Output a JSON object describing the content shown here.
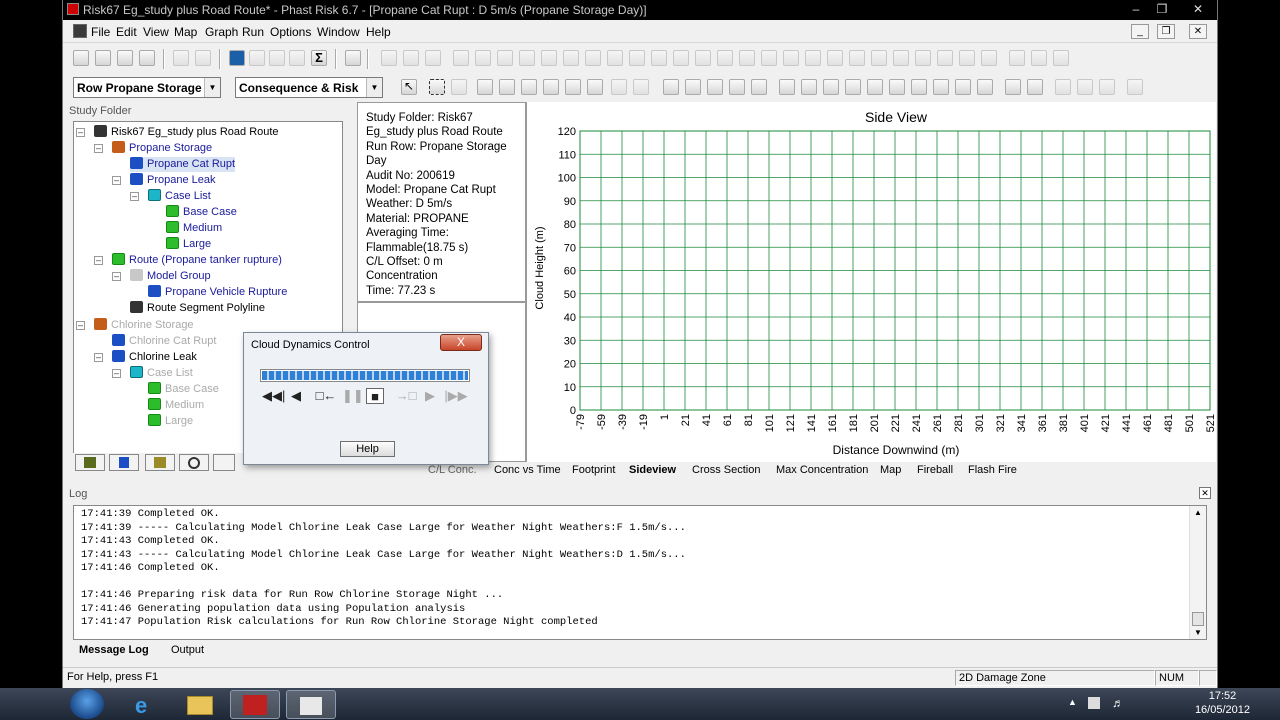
{
  "window": {
    "title": "Risk67 Eg_study plus Road Route* - Phast Risk 6.7 - [Propane Cat Rupt : D 5m/s (Propane Storage Day)]"
  },
  "menu": [
    "File",
    "Edit",
    "View",
    "Map",
    "Graph",
    "Run",
    "Options",
    "Window",
    "Help"
  ],
  "toolbar": {
    "run_row_combo": "Row Propane Storage",
    "results_combo": "Consequence & Risk"
  },
  "study_folder": {
    "title": "Study Folder",
    "nodes": [
      {
        "label": "Risk67 Eg_study plus Road Route"
      },
      {
        "label": "Propane Storage"
      },
      {
        "label": "Propane Cat Rupt"
      },
      {
        "label": "Propane Leak"
      },
      {
        "label": "Case List"
      },
      {
        "label": "Base Case"
      },
      {
        "label": "Medium"
      },
      {
        "label": "Large"
      },
      {
        "label": "Route (Propane tanker rupture)"
      },
      {
        "label": "Model Group"
      },
      {
        "label": "Propane Vehicle Rupture"
      },
      {
        "label": "Route Segment Polyline"
      },
      {
        "label": "Chlorine Storage"
      },
      {
        "label": "Chlorine Cat Rupt"
      },
      {
        "label": "Chlorine Leak"
      },
      {
        "label": "Case List"
      },
      {
        "label": "Base Case"
      },
      {
        "label": "Medium"
      },
      {
        "label": "Large"
      }
    ]
  },
  "info_panel": {
    "lines": [
      "Study Folder: Risk67",
      "Eg_study plus Road Route",
      "Run Row: Propane Storage",
      "Day",
      "Audit No: 200619",
      "Model: Propane Cat Rupt",
      "Weather: D 5m/s",
      "Material: PROPANE",
      "Averaging Time:",
      "Flammable(18.75 s)",
      "C/L Offset: 0 m",
      "Concentration",
      "Time: 77.23 s"
    ]
  },
  "chart_data": {
    "type": "line",
    "title": "Side View",
    "xlabel": "Distance Downwind (m)",
    "ylabel": "Cloud Height (m)",
    "xlim": [
      -79,
      521
    ],
    "ylim": [
      0,
      120
    ],
    "x_ticks": [
      "-79",
      "-59",
      "-39",
      "-19",
      "1",
      "21",
      "41",
      "61",
      "81",
      "101",
      "121",
      "141",
      "161",
      "181",
      "201",
      "221",
      "241",
      "261",
      "281",
      "301",
      "321",
      "341",
      "361",
      "381",
      "401",
      "421",
      "441",
      "461",
      "481",
      "501",
      "521"
    ],
    "y_ticks": [
      "0",
      "10",
      "20",
      "30",
      "40",
      "50",
      "60",
      "70",
      "80",
      "90",
      "100",
      "110",
      "120"
    ],
    "grid": true,
    "grid_color": "#1a8a3a",
    "series": []
  },
  "view_tabs": [
    "C/L Conc.",
    "Conc vs Time",
    "Footprint",
    "Sideview",
    "Cross Section",
    "Max Concentration",
    "Map",
    "Fireball",
    "Flash Fire"
  ],
  "active_view_tab": "Sideview",
  "dialog": {
    "title": "Cloud Dynamics Control",
    "progress": 1.0,
    "help_label": "Help",
    "close_label": "X"
  },
  "log": {
    "title": "Log",
    "lines": [
      "17:41:39 Completed OK.",
      "17:41:39 ----- Calculating Model Chlorine Leak Case Large for Weather Night Weathers:F 1.5m/s...",
      "17:41:43 Completed OK.",
      "17:41:43 ----- Calculating Model Chlorine Leak Case Large for Weather Night Weathers:D 1.5m/s...",
      "17:41:46 Completed OK.",
      "",
      "17:41:46 Preparing risk data for Run Row Chlorine Storage Night ...",
      "17:41:46 Generating population data using Population analysis",
      "17:41:47 Population Risk calculations for Run Row Chlorine Storage Night completed"
    ],
    "tabs": [
      "Message Log",
      "Output"
    ]
  },
  "status": {
    "help": "For Help, press F1",
    "zone": "2D Damage Zone",
    "num": "NUM"
  },
  "taskbar": {
    "time": "17:52",
    "date": "16/05/2012"
  }
}
